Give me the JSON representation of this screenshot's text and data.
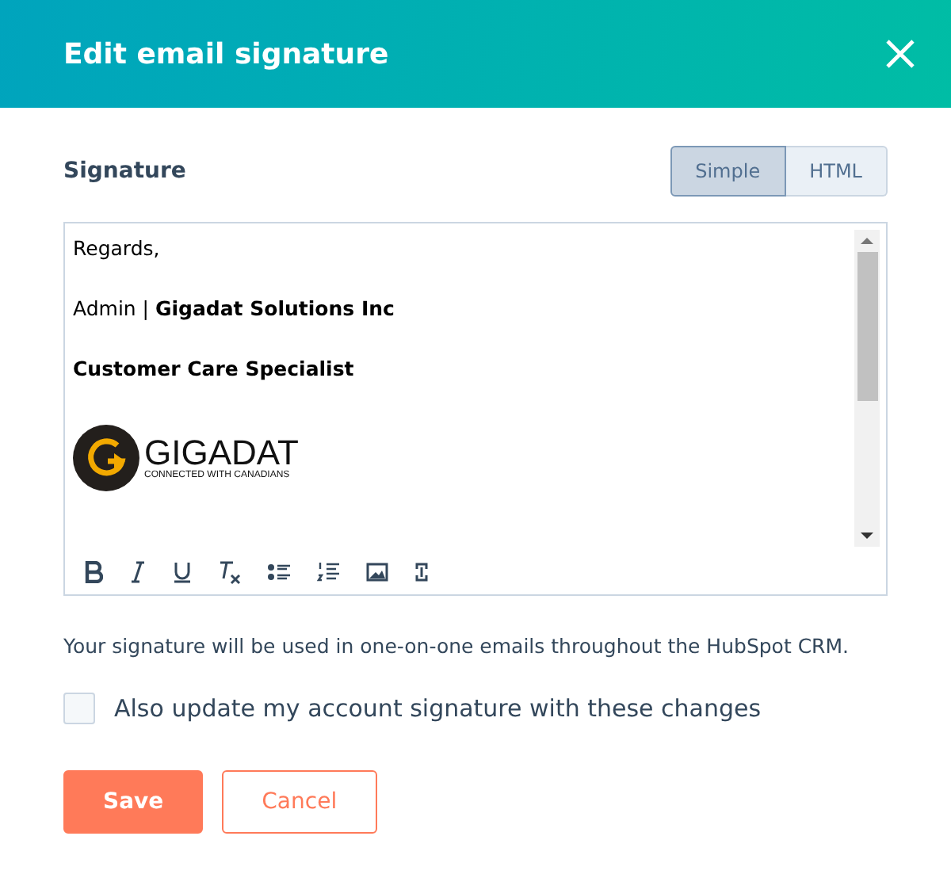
{
  "dialog": {
    "title": "Edit email signature"
  },
  "signature": {
    "label": "Signature",
    "modes": [
      {
        "label": "Simple",
        "selected": true
      },
      {
        "label": "HTML",
        "selected": false
      }
    ],
    "lines": [
      {
        "kind": "text",
        "text": "Regards,"
      },
      {
        "kind": "text",
        "text": "Admin | **Gigadat Solutions Inc**"
      },
      {
        "kind": "bold",
        "text": "Customer Care Specialist"
      },
      {
        "kind": "logo",
        "name": "GIGADAT",
        "tagline": "CONNECTED WITH CANADIANS"
      }
    ],
    "toolbar": [
      {
        "kind": "bold"
      },
      {
        "kind": "italic"
      },
      {
        "kind": "underline"
      },
      {
        "kind": "clear"
      },
      {
        "kind": "bullets"
      },
      {
        "kind": "numbers"
      },
      {
        "kind": "image"
      },
      {
        "kind": "link"
      }
    ]
  },
  "help_text": "Your signature will be used in one-on-one emails throughout the HubSpot CRM.",
  "update_account": {
    "label": "Also update my account signature with these changes",
    "checked": false
  },
  "buttons": [
    {
      "kind": "primary",
      "label": "Save"
    },
    {
      "kind": "secondary",
      "label": "Cancel"
    }
  ]
}
